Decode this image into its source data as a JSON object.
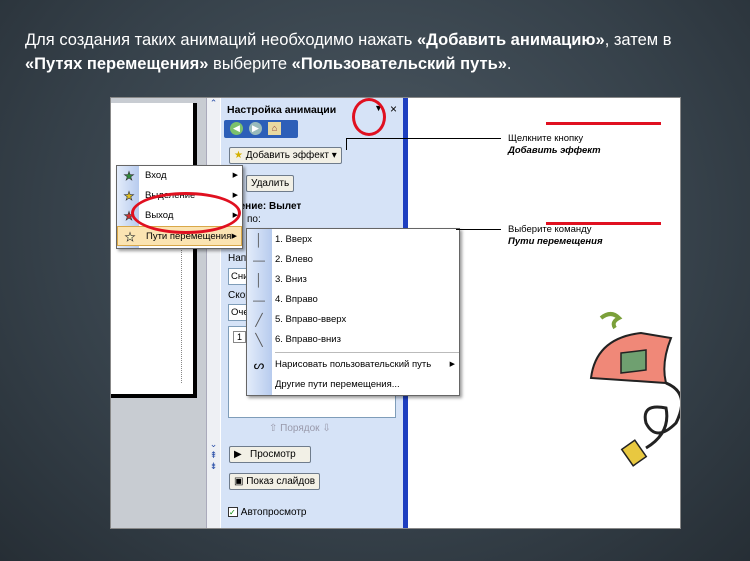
{
  "caption": {
    "p1": "Для создания таких анимаций необходимо нажать ",
    "b1": "«Добавить анимацию»",
    "p2": ", затем в ",
    "b2": "«Путях перемещения»",
    "p3": " выберите ",
    "b3": "«Пользовательский путь»",
    "p4": "."
  },
  "pane": {
    "title": "Настройка анимации",
    "add_effect": "Добавить эффект",
    "delete": "Удалить",
    "change_label": "енение: Вылет",
    "start_label": "по:",
    "direction_label": "Напр",
    "direction_value": "Сни",
    "speed_label": "Скор",
    "speed_value": "Оче",
    "list_item": "1",
    "order": "Порядок",
    "preview": "Просмотр",
    "slideshow": "Показ слайдов",
    "autopreview": "Автопросмотр"
  },
  "effect_menu": [
    {
      "label": "Вход",
      "color": "#2e8b3a"
    },
    {
      "label": "Выделение",
      "color": "#e0c020"
    },
    {
      "label": "Выход",
      "color": "#d03030"
    },
    {
      "label": "Пути перемещения",
      "color": "#fff6c0"
    }
  ],
  "paths_menu": [
    {
      "label": "1. Вверх",
      "icon": "│"
    },
    {
      "label": "2. Влево",
      "icon": "—"
    },
    {
      "label": "3. Вниз",
      "icon": "│"
    },
    {
      "label": "4. Вправо",
      "icon": "—"
    },
    {
      "label": "5. Вправо-вверх",
      "icon": "╱"
    },
    {
      "label": "6. Вправо-вниз",
      "icon": "╲"
    }
  ],
  "paths_extra": {
    "draw": "Нарисовать пользовательский путь",
    "draw_icon": "ᔕ",
    "other": "Другие пути перемещения..."
  },
  "notes": [
    {
      "line1": "Щелкните кнопку",
      "line2": "Добавить эффект"
    },
    {
      "line1": "Выберите команду",
      "line2": "Пути перемещения"
    }
  ]
}
